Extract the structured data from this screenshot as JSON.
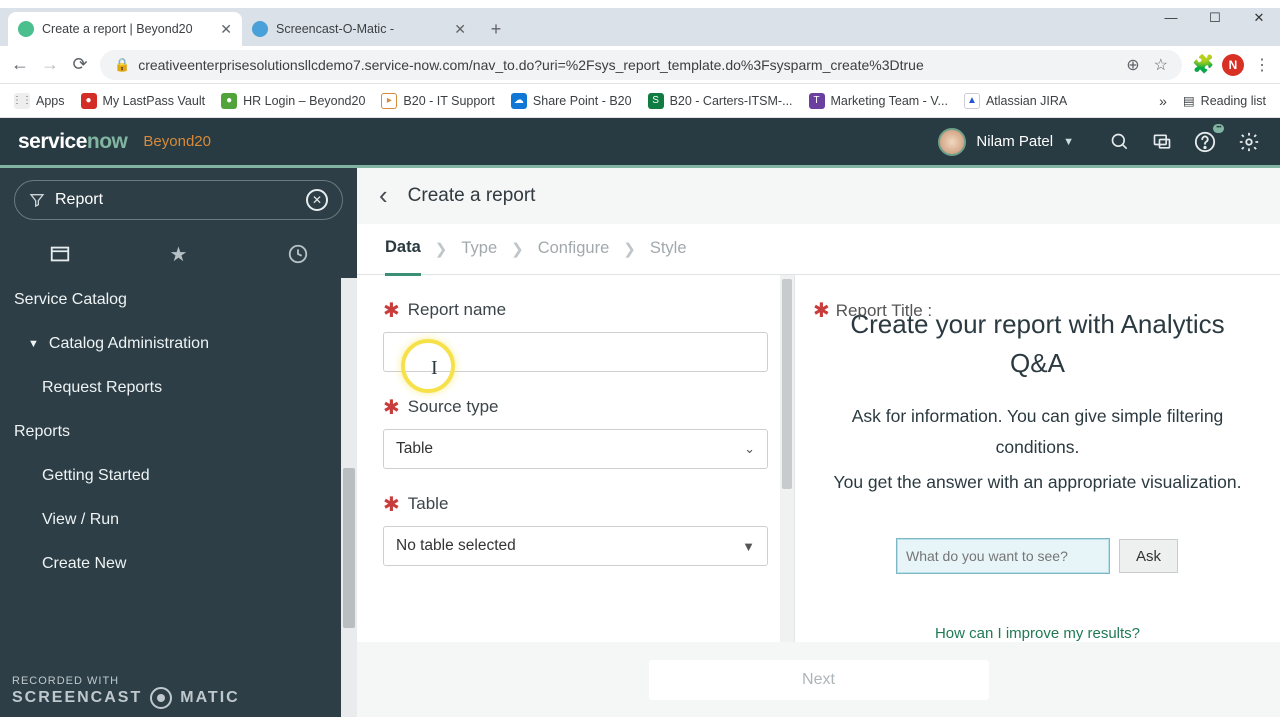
{
  "browser": {
    "tabs": [
      {
        "title": "Create a report | Beyond20",
        "favicon_color": "#4bbf8d"
      },
      {
        "title": "Screencast-O-Matic -",
        "favicon_color": "#4aa0d8"
      }
    ],
    "url": "creativeenterprisesolutionsllcdemo7.service-now.com/nav_to.do?uri=%2Fsys_report_template.do%3Fsysparm_create%3Dtrue",
    "profile_initial": "N",
    "bookmarks": [
      {
        "label": "Apps",
        "color": "#5f6368"
      },
      {
        "label": "My LastPass Vault",
        "color": "#d32d27"
      },
      {
        "label": "HR Login – Beyond20",
        "color": "#52a33a"
      },
      {
        "label": "B20 - IT Support",
        "color": "#d68a3a"
      },
      {
        "label": "Share Point - B20",
        "color": "#1078d4"
      },
      {
        "label": "B20 - Carters-ITSM-...",
        "color": "#107c41"
      },
      {
        "label": "Marketing Team - V...",
        "color": "#6b3fa0"
      },
      {
        "label": "Atlassian JIRA",
        "color": "#2157d6"
      }
    ],
    "overflow_label": "»",
    "reading_list": "Reading list"
  },
  "header": {
    "logo_a": "service",
    "logo_b": "now",
    "sub": "Beyond20",
    "user": "Nilam Patel"
  },
  "nav": {
    "filter_value": "Report",
    "items": {
      "service_catalog": "Service Catalog",
      "catalog_admin": "Catalog Administration",
      "request_reports": "Request Reports",
      "reports": "Reports",
      "getting_started": "Getting Started",
      "view_run": "View / Run",
      "create_new": "Create New"
    }
  },
  "page": {
    "title": "Create a report",
    "steps": {
      "data": "Data",
      "type": "Type",
      "configure": "Configure",
      "style": "Style"
    },
    "fields": {
      "report_name": {
        "label": "Report name",
        "value": ""
      },
      "source_type": {
        "label": "Source type",
        "value": "Table"
      },
      "table": {
        "label": "Table",
        "value": "No table selected"
      }
    },
    "next_label": "Next"
  },
  "qa": {
    "report_title": "Report Title :",
    "heading": "Create your report with Analytics Q&A",
    "p1": "Ask for information. You can give simple filtering conditions.",
    "p2": "You get the answer with an appropriate visualization.",
    "placeholder": "What do you want to see?",
    "ask": "Ask",
    "improve": "How can I improve my results?"
  },
  "watermark": {
    "line1": "RECORDED WITH",
    "brand_a": "SCREENCAST",
    "brand_b": "MATIC"
  }
}
